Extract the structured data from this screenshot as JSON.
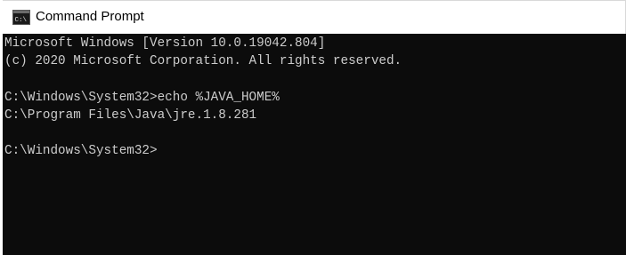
{
  "window": {
    "title": "Command Prompt",
    "icon": "cmd-icon"
  },
  "console": {
    "lines": [
      "Microsoft Windows [Version 10.0.19042.804]",
      "(c) 2020 Microsoft Corporation. All rights reserved.",
      "",
      "C:\\Windows\\System32>echo %JAVA_HOME%",
      "C:\\Program Files\\Java\\jre.1.8.281",
      "",
      "C:\\Windows\\System32>"
    ]
  },
  "colors": {
    "console_bg": "#0c0c0c",
    "console_text": "#cccccc",
    "titlebar_bg": "#ffffff"
  }
}
